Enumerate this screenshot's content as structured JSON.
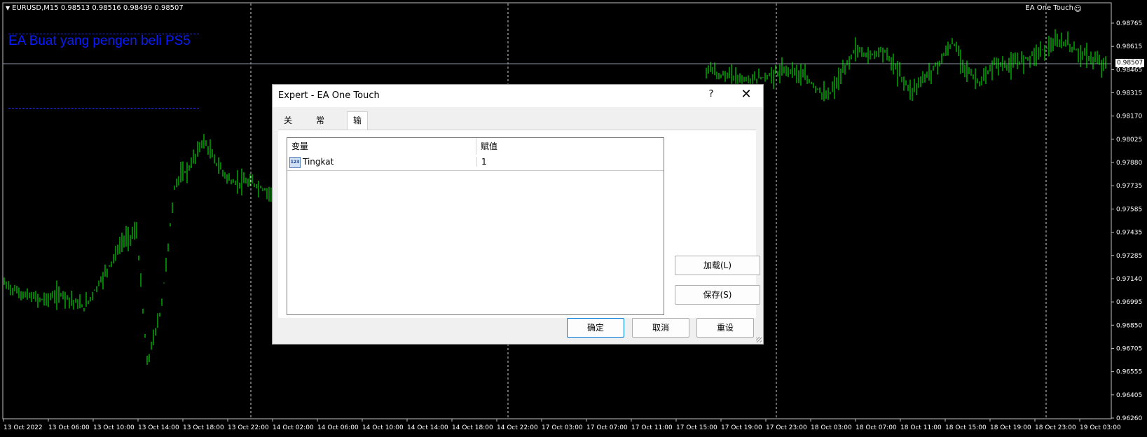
{
  "chart": {
    "symbol_header": "EURUSD,M15  0.98513 0.98516 0.98499 0.98507",
    "expert_name": "EA One Touch",
    "smiley_icon": "☺",
    "overlay_title": "EA Buat yang pengen beli PS5",
    "current_price": "0.98507",
    "price_labels": [
      "0.98765",
      "0.98615",
      "0.98465",
      "0.98315",
      "0.98170",
      "0.98025",
      "0.97880",
      "0.97735",
      "0.97585",
      "0.97435",
      "0.97285",
      "0.97140",
      "0.96995",
      "0.96850",
      "0.96705",
      "0.96555",
      "0.96405",
      "0.96260"
    ],
    "time_labels": [
      "13 Oct 2022",
      "13 Oct 06:00",
      "13 Oct 10:00",
      "13 Oct 14:00",
      "13 Oct 18:00",
      "13 Oct 22:00",
      "14 Oct 02:00",
      "14 Oct 06:00",
      "14 Oct 10:00",
      "14 Oct 14:00",
      "14 Oct 18:00",
      "14 Oct 22:00",
      "17 Oct 03:00",
      "17 Oct 07:00",
      "17 Oct 11:00",
      "17 Oct 15:00",
      "17 Oct 19:00",
      "17 Oct 23:00",
      "18 Oct 03:00",
      "18 Oct 07:00",
      "18 Oct 11:00",
      "18 Oct 15:00",
      "18 Oct 19:00",
      "18 Oct 23:00",
      "19 Oct 03:00"
    ],
    "candle_color": "#00ff00",
    "background": "#000000"
  },
  "dialog": {
    "title": "Expert - EA One Touch",
    "help_label": "?",
    "close_label": "✕",
    "tabs": [
      {
        "label": "关于"
      },
      {
        "label": "常用"
      },
      {
        "label": "输入参数"
      }
    ],
    "table": {
      "col_variable": "变量",
      "col_value": "赋值",
      "rows": [
        {
          "icon": "123",
          "name": "Tingkat",
          "value": "1"
        }
      ]
    },
    "buttons": {
      "load": "加载(L)",
      "save": "保存(S)",
      "ok": "确定",
      "cancel": "取消",
      "reset": "重设"
    }
  }
}
